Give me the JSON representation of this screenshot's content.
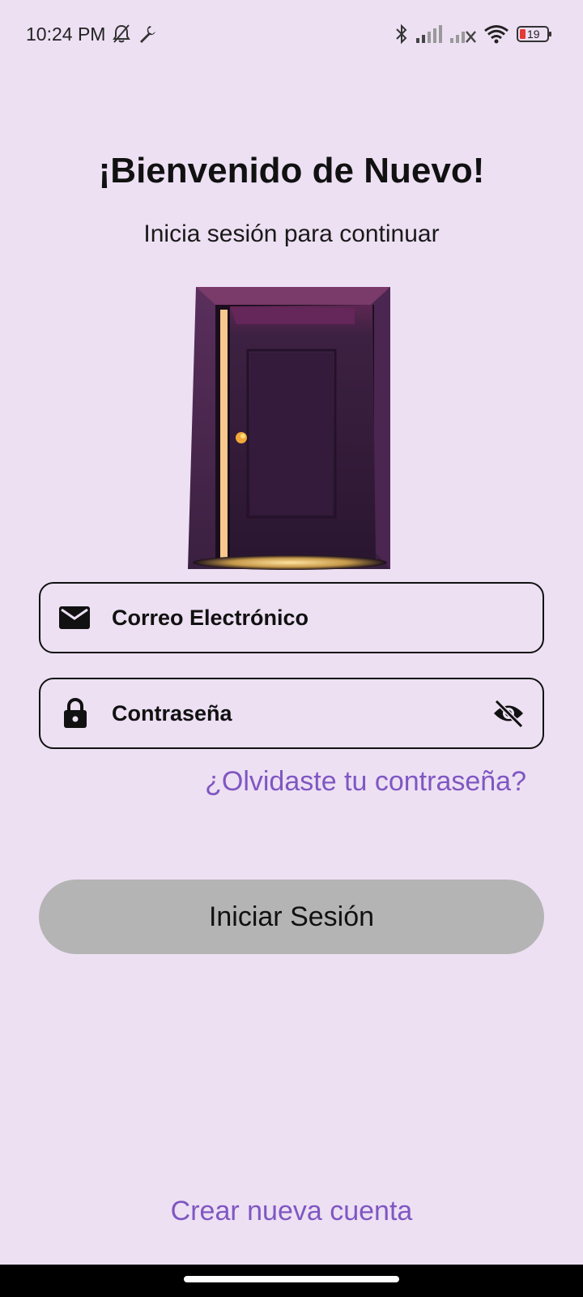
{
  "status_bar": {
    "time": "10:24 PM",
    "battery_level": "19",
    "icons": [
      "bell-off-icon",
      "wrench-icon",
      "bluetooth-icon",
      "signal-icon",
      "signal-no-service-icon",
      "wifi-icon",
      "battery-icon"
    ]
  },
  "login": {
    "title": "¡Bienvenido de Nuevo!",
    "subtitle": "Inicia sesión para continuar",
    "email": {
      "placeholder": "Correo Electrónico",
      "value": "",
      "icon": "mail-icon"
    },
    "password": {
      "placeholder": "Contraseña",
      "value": "",
      "icon": "lock-icon",
      "toggle_icon": "eye-off-icon"
    },
    "forgot_password": "¿Olvidaste tu contraseña?",
    "submit_label": "Iniciar Sesión",
    "create_account": "Crear nueva cuenta"
  },
  "colors": {
    "background": "#ede0f3",
    "link": "#7f57c2",
    "button_disabled": "#b4b4b4",
    "door": "#3e2245"
  }
}
